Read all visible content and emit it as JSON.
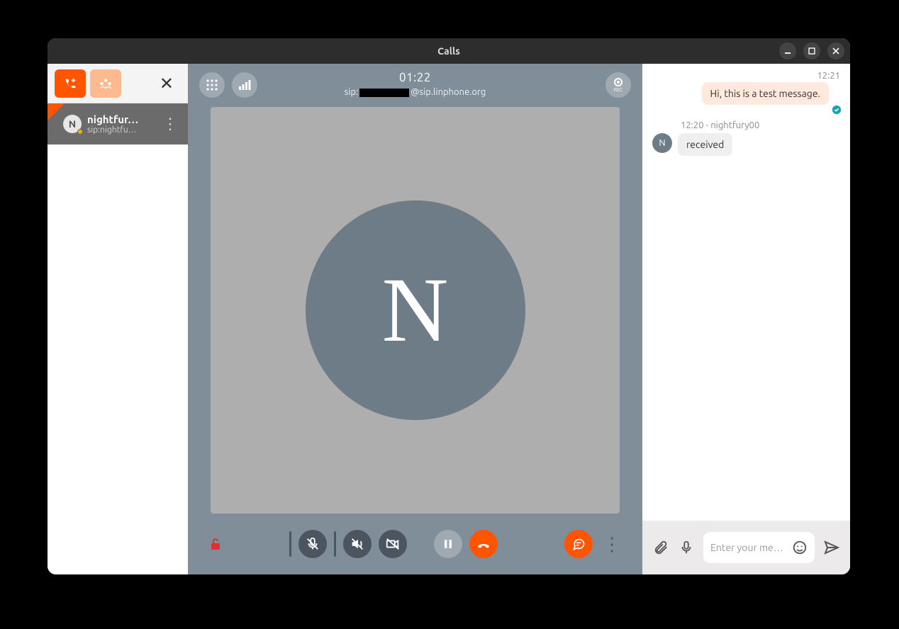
{
  "window": {
    "title": "Calls"
  },
  "sidebar": {
    "active_call": {
      "avatar_letter": "N",
      "name": "nightfur…",
      "sub": "sip:nightfu…"
    }
  },
  "call": {
    "timer": "01:22",
    "sip_prefix": "sip:",
    "sip_suffix": "@sip.linphone.org",
    "avatar_letter": "N",
    "rec_label": "REC"
  },
  "chat": {
    "out_time": "12:21",
    "out_text": "Hi, this is a test message.",
    "in_header": "12:20 - nightfury00",
    "in_avatar": "N",
    "in_text": "received",
    "input_placeholder": "Enter your me…"
  }
}
